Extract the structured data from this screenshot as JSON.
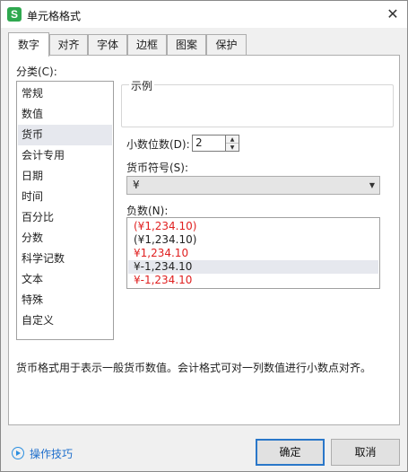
{
  "title": "单元格格式",
  "app_icon_letter": "S",
  "tabs": [
    "数字",
    "对齐",
    "字体",
    "边框",
    "图案",
    "保护"
  ],
  "active_tab": "数字",
  "category_label": "分类(C):",
  "categories": [
    "常规",
    "数值",
    "货币",
    "会计专用",
    "日期",
    "时间",
    "百分比",
    "分数",
    "科学记数",
    "文本",
    "特殊",
    "自定义"
  ],
  "selected_category": "货币",
  "sample_label": "示例",
  "sample_value": "",
  "decimal_label": "小数位数(D):",
  "decimal_value": "2",
  "symbol_label": "货币符号(S):",
  "symbol_value": "¥",
  "negative_label": "负数(N):",
  "negative_formats": [
    {
      "text": "(¥1,234.10)",
      "red": true
    },
    {
      "text": "(¥1,234.10)",
      "red": false
    },
    {
      "text": "¥1,234.10",
      "red": true
    },
    {
      "text": "¥-1,234.10",
      "red": false
    },
    {
      "text": "¥-1,234.10",
      "red": true
    }
  ],
  "selected_negative_index": 3,
  "description": "货币格式用于表示一般货币数值。会计格式可对一列数值进行小数点对齐。",
  "tips_label": "操作技巧",
  "ok_label": "确定",
  "cancel_label": "取消",
  "colors": {
    "negative_red": "#e02020",
    "accent": "#2a77c9",
    "link": "#1f6fcc",
    "brand_green": "#2fa84f"
  }
}
